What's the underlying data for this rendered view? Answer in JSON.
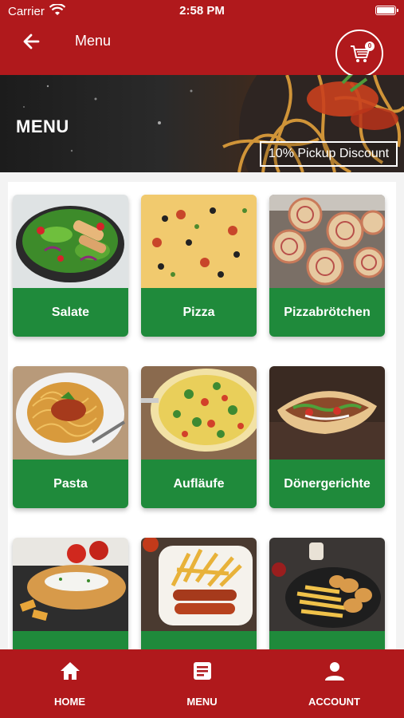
{
  "status_bar": {
    "carrier": "Carrier",
    "time": "2:58 PM"
  },
  "header": {
    "title": "Menu",
    "cart_count": "0"
  },
  "banner": {
    "title": "MENU",
    "discount": "10% Pickup Discount"
  },
  "categories": [
    {
      "label": "Salate"
    },
    {
      "label": "Pizza"
    },
    {
      "label": "Pizzabrötchen"
    },
    {
      "label": "Pasta"
    },
    {
      "label": "Aufläufe"
    },
    {
      "label": "Dönergerichte"
    },
    {
      "label": ""
    },
    {
      "label": ""
    },
    {
      "label": ""
    }
  ],
  "bottom_nav": [
    {
      "label": "HOME",
      "icon": "home-icon"
    },
    {
      "label": "MENU",
      "icon": "menu-document-icon"
    },
    {
      "label": "ACCOUNT",
      "icon": "account-icon"
    }
  ],
  "colors": {
    "primary": "#b0191c",
    "accent": "#1f8a3b"
  }
}
